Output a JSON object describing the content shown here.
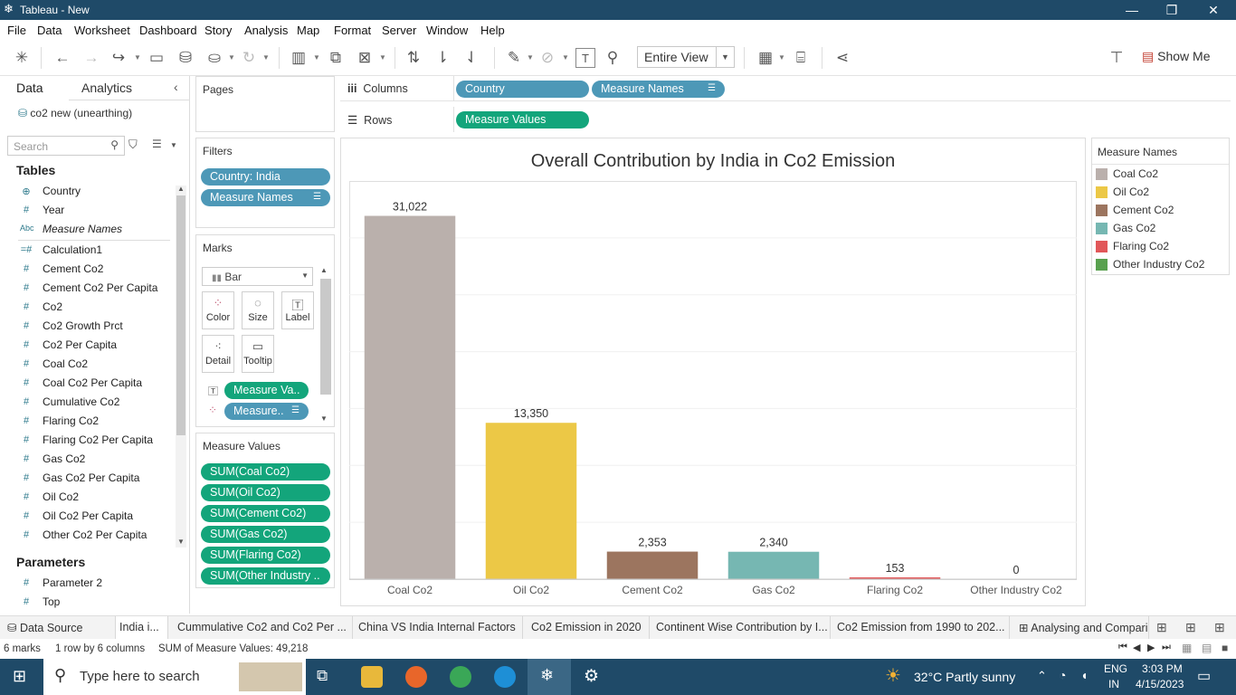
{
  "window": {
    "title": "Tableau - New",
    "minimize": "—",
    "restore": "❐",
    "close": "✕"
  },
  "menu": [
    "File",
    "Data",
    "Worksheet",
    "Dashboard",
    "Story",
    "Analysis",
    "Map",
    "Format",
    "Server",
    "Window",
    "Help"
  ],
  "toolbar": {
    "view_select": "Entire View",
    "show_me": "Show Me"
  },
  "data_pane": {
    "tab_data": "Data",
    "tab_analytics": "Analytics",
    "datasource": "co2 new (unearthing)",
    "search_placeholder": "Search",
    "tables_heading": "Tables",
    "fields": [
      {
        "icon": "⊕",
        "name": "Country"
      },
      {
        "icon": "#",
        "name": "Year"
      },
      {
        "icon": "Abc",
        "name": "Measure Names"
      },
      {
        "icon": "=#",
        "name": "Calculation1"
      },
      {
        "icon": "#",
        "name": "Cement Co2"
      },
      {
        "icon": "#",
        "name": "Cement Co2 Per Capita"
      },
      {
        "icon": "#",
        "name": "Co2"
      },
      {
        "icon": "#",
        "name": "Co2 Growth Prct"
      },
      {
        "icon": "#",
        "name": "Co2 Per Capita"
      },
      {
        "icon": "#",
        "name": "Coal Co2"
      },
      {
        "icon": "#",
        "name": "Coal Co2 Per Capita"
      },
      {
        "icon": "#",
        "name": "Cumulative Co2"
      },
      {
        "icon": "#",
        "name": "Flaring Co2"
      },
      {
        "icon": "#",
        "name": "Flaring Co2 Per Capita"
      },
      {
        "icon": "#",
        "name": "Gas Co2"
      },
      {
        "icon": "#",
        "name": "Gas Co2 Per Capita"
      },
      {
        "icon": "#",
        "name": "Oil Co2"
      },
      {
        "icon": "#",
        "name": "Oil Co2 Per Capita"
      },
      {
        "icon": "#",
        "name": "Other Co2 Per Capita"
      }
    ],
    "parameters_heading": "Parameters",
    "parameters": [
      {
        "icon": "#",
        "name": "Parameter 2"
      },
      {
        "icon": "#",
        "name": "Top"
      }
    ]
  },
  "pages": {
    "title": "Pages"
  },
  "filters": {
    "title": "Filters",
    "pills": [
      "Country: India",
      "Measure Names"
    ]
  },
  "marks": {
    "title": "Marks",
    "type": "Bar",
    "buttons": [
      "Color",
      "Size",
      "Label",
      "Detail",
      "Tooltip"
    ],
    "pills": [
      "Measure Va..",
      "Measure.."
    ]
  },
  "measure_values": {
    "title": "Measure Values",
    "pills": [
      "SUM(Coal Co2)",
      "SUM(Oil Co2)",
      "SUM(Cement Co2)",
      "SUM(Gas Co2)",
      "SUM(Flaring Co2)",
      "SUM(Other Industry .."
    ]
  },
  "shelves": {
    "columns_label": "Columns",
    "rows_label": "Rows",
    "columns": [
      "Country",
      "Measure Names"
    ],
    "rows": [
      "Measure Values"
    ]
  },
  "chart_data": {
    "type": "bar",
    "title": "Overall Contribution by India in Co2 Emission",
    "categories": [
      "Coal Co2",
      "Oil Co2",
      "Cement Co2",
      "Gas Co2",
      "Flaring Co2",
      "Other Industry Co2"
    ],
    "values": [
      31022,
      13350,
      2353,
      2340,
      153,
      0
    ],
    "labels": [
      "31,022",
      "13,350",
      "2,353",
      "2,340",
      "153",
      "0"
    ],
    "colors": [
      "#bab0ac",
      "#ecc846",
      "#9c755f",
      "#76b7b2",
      "#e15759",
      "#59a14f"
    ],
    "ylim": [
      0,
      34000
    ],
    "grid": true,
    "xlabel": "",
    "ylabel": ""
  },
  "legend": {
    "title": "Measure Names",
    "items": [
      {
        "label": "Coal Co2",
        "color": "#bab0ac"
      },
      {
        "label": "Oil Co2",
        "color": "#ecc846"
      },
      {
        "label": "Cement Co2",
        "color": "#9c755f"
      },
      {
        "label": "Gas Co2",
        "color": "#76b7b2"
      },
      {
        "label": "Flaring Co2",
        "color": "#e15759"
      },
      {
        "label": "Other Industry Co2",
        "color": "#59a14f"
      }
    ]
  },
  "sheet_tabs": [
    "Data Source",
    "India i...",
    "Cummulative Co2 and Co2 Per ...",
    "China VS India Internal Factors",
    "Co2 Emission in 2020",
    "Continent Wise Contribution by I...",
    "Co2 Emission from 1990 to 202...",
    "Analysing and Compari"
  ],
  "status": {
    "marks": "6 marks",
    "dims": "1 row by 6 columns",
    "sum": "SUM of Measure Values: 49,218"
  },
  "taskbar": {
    "search_placeholder": "Type here to search",
    "weather": "32°C  Partly sunny",
    "lang1": "ENG",
    "lang2": "IN",
    "time": "3:03 PM",
    "date": "4/15/2023"
  }
}
